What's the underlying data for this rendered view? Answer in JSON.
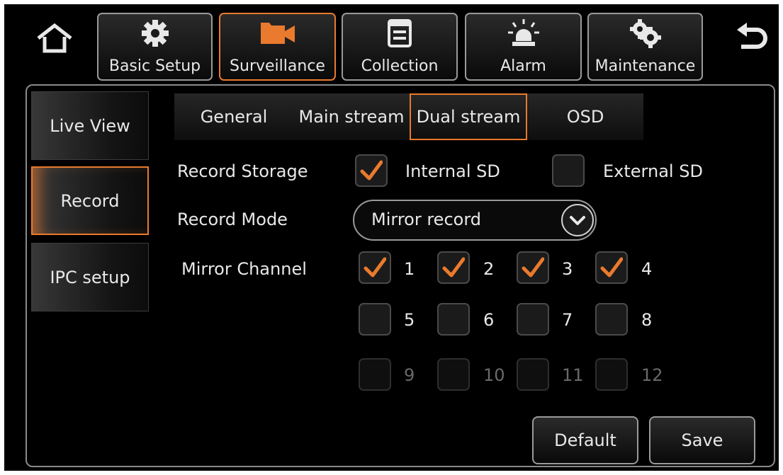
{
  "nav": {
    "tabs": [
      {
        "label": "Basic Setup",
        "icon": "gear-icon"
      },
      {
        "label": "Surveillance",
        "icon": "camera-icon"
      },
      {
        "label": "Collection",
        "icon": "document-icon"
      },
      {
        "label": "Alarm",
        "icon": "siren-icon"
      },
      {
        "label": "Maintenance",
        "icon": "gears-icon"
      }
    ],
    "active_tab": "Surveillance"
  },
  "sidebar": {
    "items": [
      {
        "label": "Live View"
      },
      {
        "label": "Record"
      },
      {
        "label": "IPC setup"
      }
    ],
    "active_item": "Record"
  },
  "subtabs": {
    "items": [
      {
        "label": "General"
      },
      {
        "label": "Main stream"
      },
      {
        "label": "Dual stream"
      },
      {
        "label": "OSD"
      }
    ],
    "active_item": "Dual stream"
  },
  "form": {
    "record_storage": {
      "label": "Record Storage",
      "options": [
        {
          "label": "Internal SD",
          "checked": true
        },
        {
          "label": "External SD",
          "checked": false
        }
      ]
    },
    "record_mode": {
      "label": "Record Mode",
      "value": "Mirror record"
    },
    "mirror_channel": {
      "label": "Mirror Channel",
      "channels": [
        {
          "n": "1",
          "checked": true
        },
        {
          "n": "2",
          "checked": true
        },
        {
          "n": "3",
          "checked": true
        },
        {
          "n": "4",
          "checked": true
        },
        {
          "n": "5",
          "checked": false
        },
        {
          "n": "6",
          "checked": false
        },
        {
          "n": "7",
          "checked": false
        },
        {
          "n": "8",
          "checked": false
        },
        {
          "n": "9",
          "checked": false,
          "disabled": true
        },
        {
          "n": "10",
          "checked": false,
          "disabled": true
        },
        {
          "n": "11",
          "checked": false,
          "disabled": true
        },
        {
          "n": "12",
          "checked": false,
          "disabled": true
        }
      ]
    }
  },
  "buttons": {
    "default_label": "Default",
    "save_label": "Save"
  },
  "colors": {
    "accent": "#e97a2e",
    "background": "#000000",
    "text": "#e8e8e8"
  }
}
